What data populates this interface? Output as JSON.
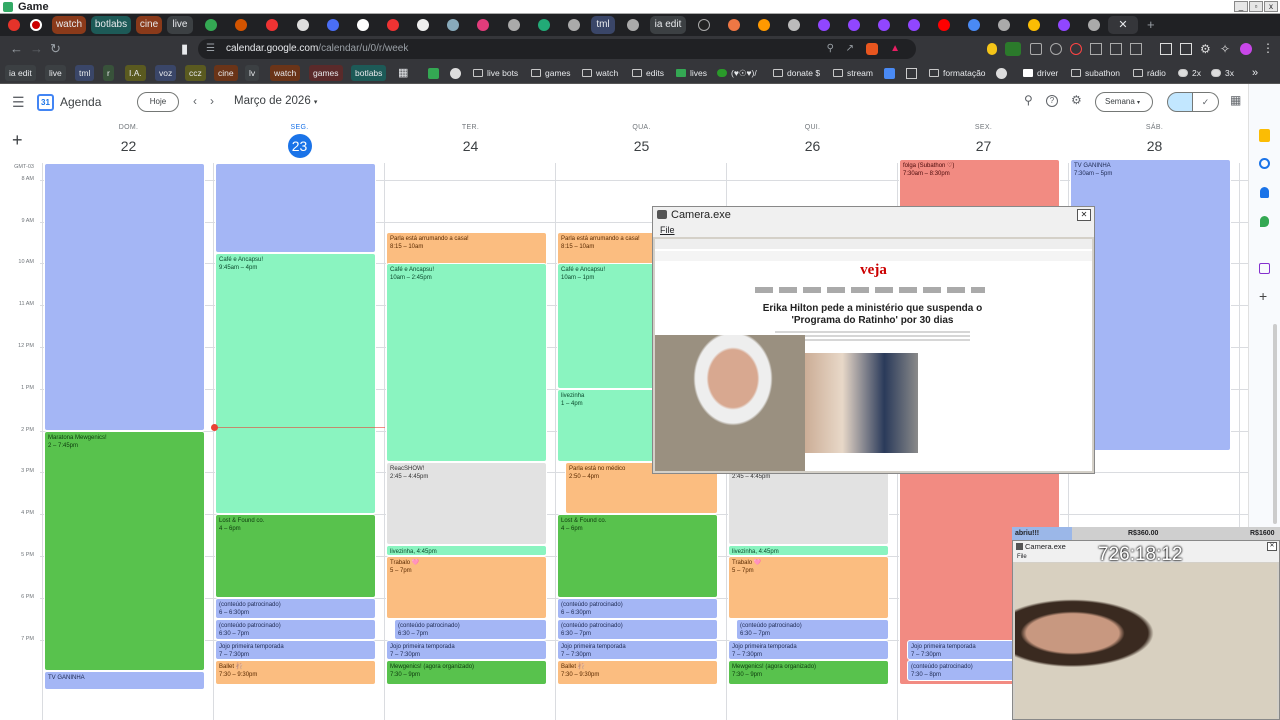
{
  "titlebar": {
    "title": "Game",
    "min": "_",
    "max": "▫",
    "close": "x"
  },
  "tabs": [
    {
      "label": "watch",
      "color": "#8a3a1a"
    },
    {
      "label": "botlabs",
      "color": "#1d5a57"
    },
    {
      "label": "cine",
      "color": "#8a3a1a"
    },
    {
      "label": "live",
      "color": "#3c4043"
    },
    {
      "label": "tml",
      "color": "#3a4668"
    },
    {
      "label": "ia edit",
      "color": "#3c4043"
    }
  ],
  "address": {
    "host": "calendar.google.com",
    "path": "/calendar/u/0/r/week",
    "close_tab": "✕",
    "new_tab": "+"
  },
  "bookmarks": [
    {
      "label": "ia edit",
      "style": "pill",
      "color": "#3c4043"
    },
    {
      "label": "live",
      "style": "pill",
      "color": "#3c4043"
    },
    {
      "label": "tml",
      "style": "pill",
      "color": "#3a4668"
    },
    {
      "label": "r",
      "style": "pill",
      "color": "#38523a"
    },
    {
      "label": "I.A.",
      "style": "pill",
      "color": "#5a5a20"
    },
    {
      "label": "voz",
      "style": "pill",
      "color": "#3a4668"
    },
    {
      "label": "ccz",
      "style": "pill",
      "color": "#5a5a20"
    },
    {
      "label": "cine",
      "style": "pill",
      "color": "#6a3418"
    },
    {
      "label": "lv",
      "style": "pill",
      "color": "#3c4043"
    },
    {
      "label": "watch",
      "style": "pill",
      "color": "#6a3418"
    },
    {
      "label": "games",
      "style": "pill",
      "color": "#5a2a2a"
    },
    {
      "label": "botlabs",
      "style": "pill",
      "color": "#1d5a57"
    },
    {
      "label": "live bots",
      "style": "folder"
    },
    {
      "label": "games",
      "style": "folder"
    },
    {
      "label": "watch",
      "style": "folder"
    },
    {
      "label": "edits",
      "style": "folder"
    },
    {
      "label": "lives",
      "style": "folder"
    },
    {
      "label": "(♥☉♥)/",
      "style": "folder"
    },
    {
      "label": "donate $",
      "style": "folder"
    },
    {
      "label": "stream",
      "style": "folder"
    },
    {
      "label": "formatação",
      "style": "folder"
    },
    {
      "label": "driver",
      "style": "folder"
    },
    {
      "label": "subathon",
      "style": "folder"
    },
    {
      "label": "rádio",
      "style": "folder"
    },
    {
      "label": "2x",
      "style": "folder"
    },
    {
      "label": "3x",
      "style": "folder"
    }
  ],
  "calendar": {
    "app_name": "Agenda",
    "today_button": "Hoje",
    "month_label": "Março de 2026",
    "view_button": "Semana",
    "timezone": "GMT-03",
    "days": [
      {
        "name": "DOM.",
        "num": "22"
      },
      {
        "name": "SEG.",
        "num": "23",
        "today": true
      },
      {
        "name": "TER.",
        "num": "24"
      },
      {
        "name": "QUA.",
        "num": "25"
      },
      {
        "name": "QUI.",
        "num": "26"
      },
      {
        "name": "SEX.",
        "num": "27"
      },
      {
        "name": "SÁB.",
        "num": "28"
      }
    ],
    "hours": [
      "8 AM",
      "9 AM",
      "10 AM",
      "11 AM",
      "12 PM",
      "1 PM",
      "2 PM",
      "3 PM",
      "4 PM",
      "5 PM",
      "6 PM",
      "7 PM"
    ],
    "events": [
      {
        "day": 0,
        "start": 7.6,
        "end": 14.0,
        "color": "blue",
        "title": "",
        "time": ""
      },
      {
        "day": 0,
        "start": 14.0,
        "end": 19.75,
        "color": "dgreen",
        "title": "Maratona Mewgenics!",
        "time": "2 – 7:45pm"
      },
      {
        "day": 0,
        "start": 19.75,
        "end": 20.2,
        "color": "blue",
        "title": "TV GANINHA",
        "time": ""
      },
      {
        "day": 1,
        "start": 7.6,
        "end": 9.75,
        "color": "blue",
        "title": "",
        "time": ""
      },
      {
        "day": 1,
        "start": 9.75,
        "end": 16.0,
        "color": "green",
        "title": "Café e Ancapsu!",
        "time": "9:45am – 4pm"
      },
      {
        "day": 1,
        "start": 16.0,
        "end": 18.0,
        "color": "dgreen",
        "title": "Lost & Found co.",
        "time": "4 – 6pm"
      },
      {
        "day": 1,
        "start": 18.0,
        "end": 18.5,
        "color": "blue",
        "title": "(conteúdo patrocinado)",
        "time": "6 – 6:30pm"
      },
      {
        "day": 1,
        "start": 18.5,
        "end": 19.0,
        "color": "blue",
        "title": "(conteúdo patrocinado)",
        "time": "6:30 – 7pm"
      },
      {
        "day": 1,
        "start": 19.0,
        "end": 19.5,
        "color": "blue",
        "title": "Jojo primeira temporada",
        "time": "7 – 7:30pm"
      },
      {
        "day": 1,
        "start": 19.5,
        "end": 20.1,
        "color": "orange",
        "title": "Ballet 🩰",
        "time": "7:30 – 9:30pm"
      },
      {
        "day": 2,
        "start": 9.25,
        "end": 11.0,
        "color": "orange",
        "title": "Parla está arrumando a casa!",
        "time": "8:15 – 10am"
      },
      {
        "day": 2,
        "start": 10.0,
        "end": 14.75,
        "color": "green",
        "title": "Café e Ancapsu!",
        "time": "10am – 2:45pm"
      },
      {
        "day": 2,
        "start": 14.75,
        "end": 16.75,
        "color": "gray",
        "title": "ReacSHOW!",
        "time": "2:45 – 4:45pm"
      },
      {
        "day": 2,
        "start": 16.75,
        "end": 17.0,
        "color": "green",
        "title": "livezinha, 4:45pm",
        "time": ""
      },
      {
        "day": 2,
        "start": 17.0,
        "end": 18.5,
        "color": "orange",
        "title": "Trabalo 🩷",
        "time": "5 – 7pm"
      },
      {
        "day": 2,
        "start": 18.5,
        "end": 19.0,
        "color": "blue",
        "title": "(conteúdo patrocinado)",
        "time": "6:30 – 7pm",
        "indent": true
      },
      {
        "day": 2,
        "start": 19.0,
        "end": 19.5,
        "color": "blue",
        "title": "Jojo primeira temporada",
        "time": "7 – 7:30pm"
      },
      {
        "day": 2,
        "start": 19.5,
        "end": 20.1,
        "color": "dgreen",
        "title": "Mewgenics! (agora organizado)",
        "time": "7:30 – 9pm"
      },
      {
        "day": 3,
        "start": 9.25,
        "end": 11.0,
        "color": "orange",
        "title": "Parla está arrumando a casa!",
        "time": "8:15 – 10am"
      },
      {
        "day": 3,
        "start": 10.0,
        "end": 13.0,
        "color": "green",
        "title": "Café e Ancapsu!",
        "time": "10am – 1pm"
      },
      {
        "day": 3,
        "start": 13.0,
        "end": 14.75,
        "color": "green",
        "title": "livezinha",
        "time": "1 – 4pm"
      },
      {
        "day": 3,
        "start": 14.75,
        "end": 16.0,
        "color": "orange",
        "title": "Parla está no médico",
        "time": "2:50 – 4pm",
        "indent": true
      },
      {
        "day": 3,
        "start": 16.0,
        "end": 18.0,
        "color": "dgreen",
        "title": "Lost & Found co.",
        "time": "4 – 6pm"
      },
      {
        "day": 3,
        "start": 18.0,
        "end": 18.5,
        "color": "blue",
        "title": "(conteúdo patrocinado)",
        "time": "6 – 6:30pm"
      },
      {
        "day": 3,
        "start": 18.5,
        "end": 19.0,
        "color": "blue",
        "title": "(conteúdo patrocinado)",
        "time": "6:30 – 7pm"
      },
      {
        "day": 3,
        "start": 19.0,
        "end": 19.5,
        "color": "blue",
        "title": "Jojo primeira temporada",
        "time": "7 – 7:30pm"
      },
      {
        "day": 3,
        "start": 19.5,
        "end": 20.1,
        "color": "orange",
        "title": "Ballet 🩰",
        "time": "7:30 – 9:30pm"
      },
      {
        "day": 4,
        "start": 14.75,
        "end": 16.75,
        "color": "gray",
        "title": "ReacSHOW!",
        "time": "2:45 – 4:45pm"
      },
      {
        "day": 4,
        "start": 16.75,
        "end": 17.0,
        "color": "green",
        "title": "livezinha, 4:45pm",
        "time": ""
      },
      {
        "day": 4,
        "start": 17.0,
        "end": 18.5,
        "color": "orange",
        "title": "Trabalo 🩷",
        "time": "5 – 7pm"
      },
      {
        "day": 4,
        "start": 18.5,
        "end": 19.0,
        "color": "blue",
        "title": "(conteúdo patrocinado)",
        "time": "6:30 – 7pm",
        "indent": true
      },
      {
        "day": 4,
        "start": 19.0,
        "end": 19.5,
        "color": "blue",
        "title": "Jojo primeira temporada",
        "time": "7 – 7:30pm"
      },
      {
        "day": 4,
        "start": 19.5,
        "end": 20.1,
        "color": "dgreen",
        "title": "Mewgenics! (agora organizado)",
        "time": "7:30 – 9pm"
      },
      {
        "day": 5,
        "start": 7.5,
        "end": 20.1,
        "color": "red",
        "title": "folga (Subathon ♡)",
        "time": "7:30am – 8:30pm"
      },
      {
        "day": 5,
        "start": 19.0,
        "end": 19.5,
        "color": "blue",
        "title": "Jojo primeira temporada",
        "time": "7 – 7:30pm",
        "indent": true
      },
      {
        "day": 5,
        "start": 19.5,
        "end": 20.0,
        "color": "blue",
        "title": "(conteúdo patrocinado)",
        "time": "7:30 – 8pm",
        "indent": true
      },
      {
        "day": 6,
        "start": 7.5,
        "end": 14.5,
        "color": "blue",
        "title": "TV GANINHA",
        "time": "7:30am – 5pm"
      }
    ]
  },
  "camera_window": {
    "title": "Camera.exe",
    "menu": "File",
    "site": "veja",
    "headline": "Erika Hilton pede a ministério que suspenda o 'Programa do Ratinho' por 30 dias",
    "close": "✕"
  },
  "donation_bar": {
    "left": "abriu!!!",
    "mid": "R$360.00",
    "right": "R$1600",
    "progress": 0.225
  },
  "webcam_window": {
    "title": "Camera.exe",
    "menu": "File",
    "timer": "726:18:12",
    "close": "✕"
  },
  "colors": {
    "blue": "#a4b6f5",
    "green": "#8af4c0",
    "dgreen": "#58c24d",
    "orange": "#fbbd80",
    "gray": "#e2e2e2",
    "red": "#f28b82",
    "today": "#1a73e8"
  }
}
